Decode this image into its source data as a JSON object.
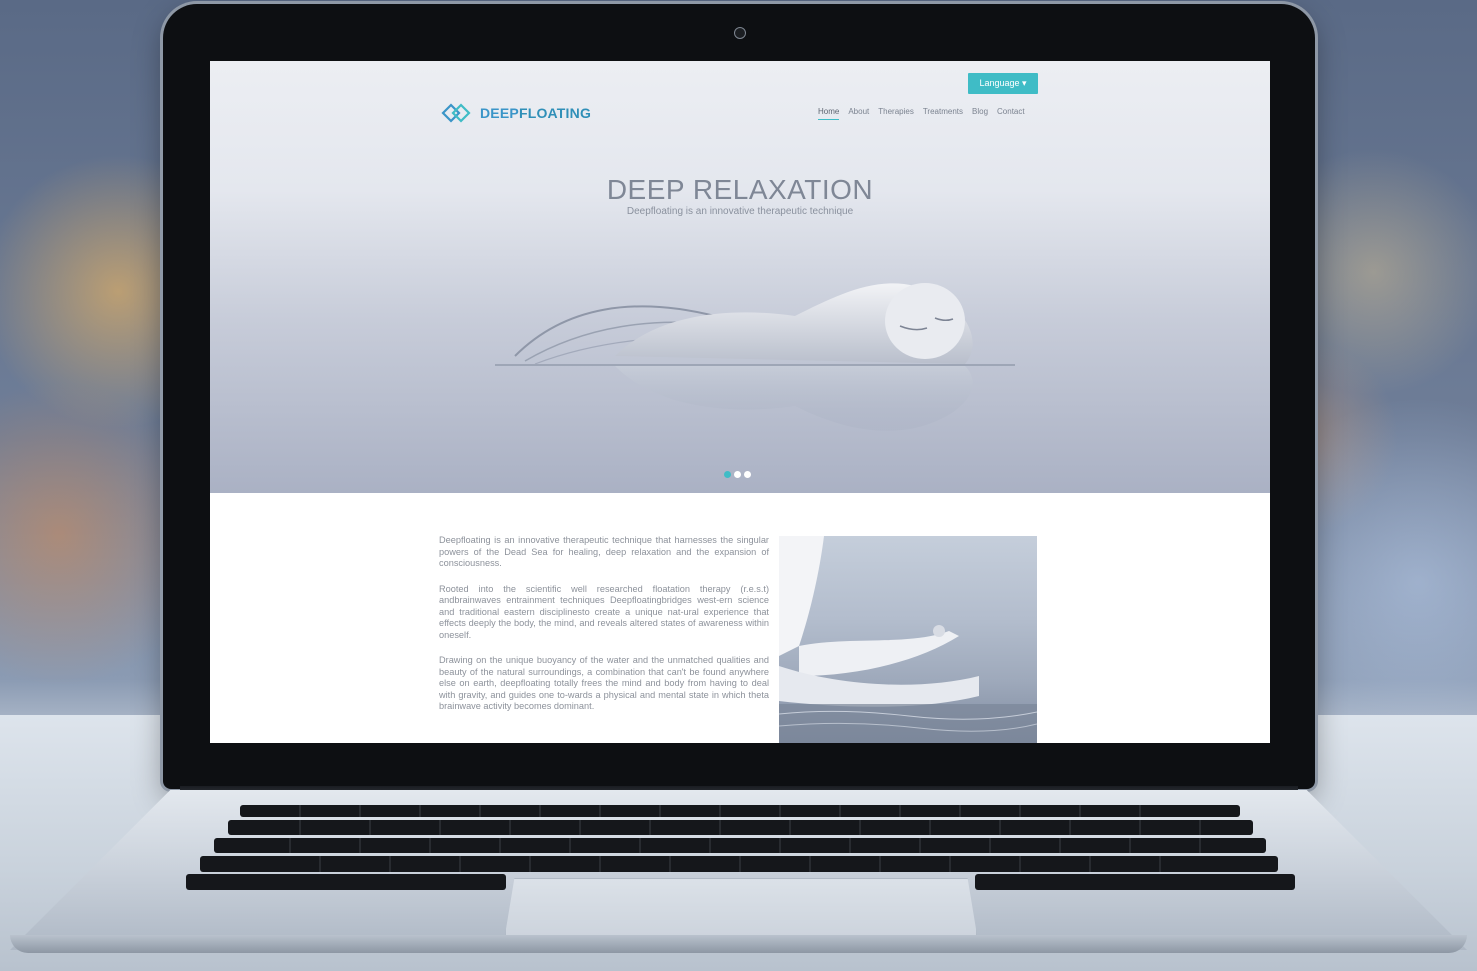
{
  "site": {
    "language_button": "Language ▾",
    "logo": {
      "brand_part1": "DEEP",
      "brand_part2": "FLOATING",
      "icon": "double-chevron-logo"
    },
    "nav": {
      "home": "Home",
      "about": "About",
      "therapies": "Therapies",
      "treatments": "Treatments",
      "blog": "Blog",
      "contact": "Contact"
    },
    "hero": {
      "title": "DEEP RELAXATION",
      "subtitle": "Deepfloating is an innovative therapeutic technique",
      "slides_total": 3,
      "active_slide": 1
    },
    "content": {
      "paragraph1": "Deepfloating is an innovative therapeutic technique that harnesses the singular powers of the Dead Sea for healing, deep relaxation and the expansion of consciousness.",
      "paragraph2": "Rooted into the scientific well researched floatation therapy (r.e.s.t) andbrainwaves entrainment techniques Deepfloatingbridges west-ern science and traditional eastern disciplinesto create a unique nat-ural experience that effects deeply the body, the mind, and reveals altered states of awareness within oneself.",
      "paragraph3": "Drawing on the unique buoyancy of the water and the unmatched qualities and beauty of the natural surroundings, a combination that can't be found anywhere else on earth, deepfloating totally frees the mind and body from having to deal with gravity, and guides one to-wards a physical and mental state in which theta brainwave activity becomes dominant."
    }
  },
  "colors": {
    "accent": "#3fbcc6",
    "brand": "#3a95c8",
    "text_muted": "#8d929b"
  }
}
